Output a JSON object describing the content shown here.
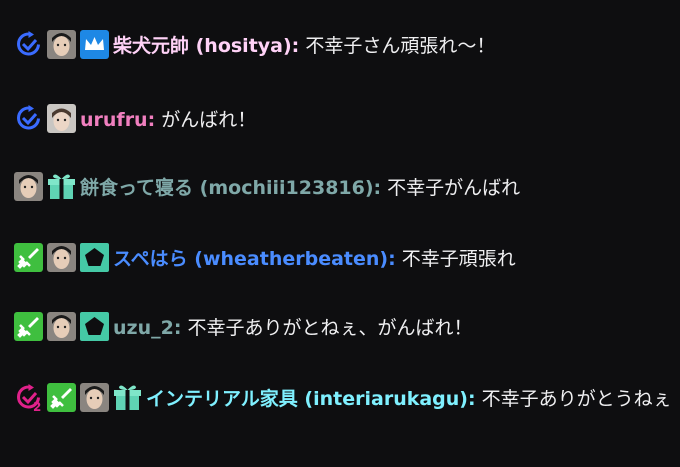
{
  "colors": {
    "background": "#0e0e10",
    "message_text": "#efeff1",
    "sub_badge": "#3a6bff",
    "sub_badge_tier2": "#e0218a",
    "crown_badge_bg": "#1e88e5",
    "sword_badge_bg": "#3fbf3f",
    "gift_badge": "#5fd3b4",
    "pentagon_badge_bg": "#45c9a6"
  },
  "messages": [
    {
      "badges": [
        "subscriber-icon",
        "avatar",
        "crown-badge-icon"
      ],
      "username": "柴犬元帥 (hositya):",
      "username_color": "#ffd2f7",
      "text": " 不幸子さん頑張れ〜！"
    },
    {
      "badges": [
        "subscriber-icon",
        "avatar"
      ],
      "username": "urufru:",
      "username_color": "#f07fbf",
      "text": " がんばれ！"
    },
    {
      "badges": [
        "avatar",
        "gift-badge-icon"
      ],
      "username": "餅食って寝る (mochiii123816):",
      "username_color": "#7fa8a8",
      "text": " 不幸子がんばれ"
    },
    {
      "badges": [
        "sword-badge-icon",
        "avatar",
        "pentagon-badge-icon"
      ],
      "username": "スペはら (wheatherbeaten):",
      "username_color": "#4a8cff",
      "text": " 不幸子頑張れ"
    },
    {
      "badges": [
        "sword-badge-icon",
        "avatar",
        "pentagon-badge-icon"
      ],
      "username": "uzu_2:",
      "username_color": "#7fa8a8",
      "text": " 不幸子ありがとねぇ、がんばれ！"
    },
    {
      "badges": [
        "subscriber-tier2-icon",
        "sword-badge-icon",
        "avatar",
        "gift-badge-icon"
      ],
      "username": "インテリアル家具 (interiarukagu):",
      "username_color": "#7ff0ff",
      "text": " 不幸子ありがとうねぇ",
      "sub_tier_label": "2"
    }
  ]
}
